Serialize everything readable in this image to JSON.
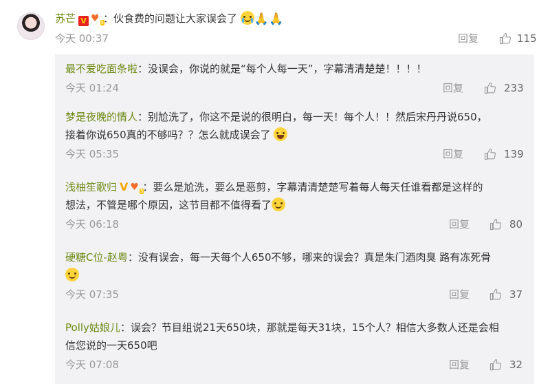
{
  "main_comment": {
    "username": "苏芒",
    "text": "：伙食费的问题让大家误会了",
    "time": "今天 00:37",
    "reply_label": "回复",
    "likes": "115"
  },
  "replies": [
    {
      "username": "最不爱吃面条啦",
      "line1": "：没误会，你说的就是“每个人每一天”，字幕清清楚楚！！！！",
      "time": "今天 01:24",
      "reply_label": "回复",
      "likes": "233"
    },
    {
      "username": "梦是夜晚的情人",
      "line1": "：别尬洗了，你这不是说的很明白，每一天！每个人！！然后宋丹丹说650，",
      "line2": "接着你说650真的不够吗？？怎么就成误会了",
      "time": "今天 05:35",
      "reply_label": "回复",
      "likes": "139"
    },
    {
      "username": "浅柚笙歌归",
      "line1": "：要么是尬洗，要么是恶剪，字幕清清楚楚写着每人每天任谁看都是这样的",
      "line2": "想法，不管是哪个原因，这节目都不值得看了",
      "time": "今天 06:18",
      "reply_label": "回复",
      "likes": "80"
    },
    {
      "username": "硬糖C位-赵粤",
      "line1": "：没有误会，每一天每个人650不够，哪来的误会？真是朱门酒肉臭 路有冻死骨",
      "time": "今天 07:35",
      "reply_label": "回复",
      "likes": "37"
    },
    {
      "username": "Polly姑娘儿",
      "line1": "：误会？节目组说21天650块，那就是每天31块，15个人？相信大多数人还是会相",
      "line2": "信您说的一天650吧",
      "time": "今天 07:08",
      "reply_label": "回复",
      "likes": "32"
    }
  ],
  "badges": {
    "verified": "V",
    "fan_level": "5"
  },
  "colors": {
    "username": "#6e8a14",
    "meta_text": "#999999",
    "reply_box_bg": "#f2f2f5"
  },
  "icons": [
    "like-icon",
    "crying-emoji-icon",
    "praying-hands-icon",
    "laughing-emoji-icon",
    "smiling-emoji-icon"
  ]
}
